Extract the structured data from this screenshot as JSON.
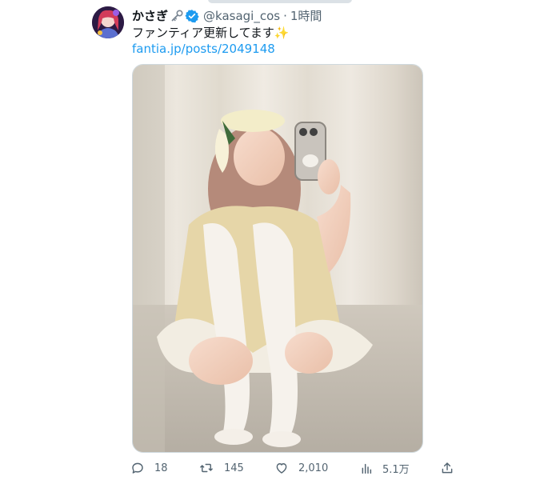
{
  "tweet": {
    "display_name": "かさぎ",
    "handle": "@kasagi_cos",
    "separator": "·",
    "time": "1時間",
    "text": "ファンティア更新してます",
    "sparkle": "✨",
    "link": "fantia.jp/posts/2049148"
  },
  "actions": {
    "reply_count": "18",
    "retweet_count": "145",
    "like_count": "2,010",
    "view_count": "5.1万"
  },
  "colors": {
    "text_primary": "#0f1419",
    "text_secondary": "#536471",
    "link": "#1d9bf0",
    "verified": "#1d9bf0"
  }
}
